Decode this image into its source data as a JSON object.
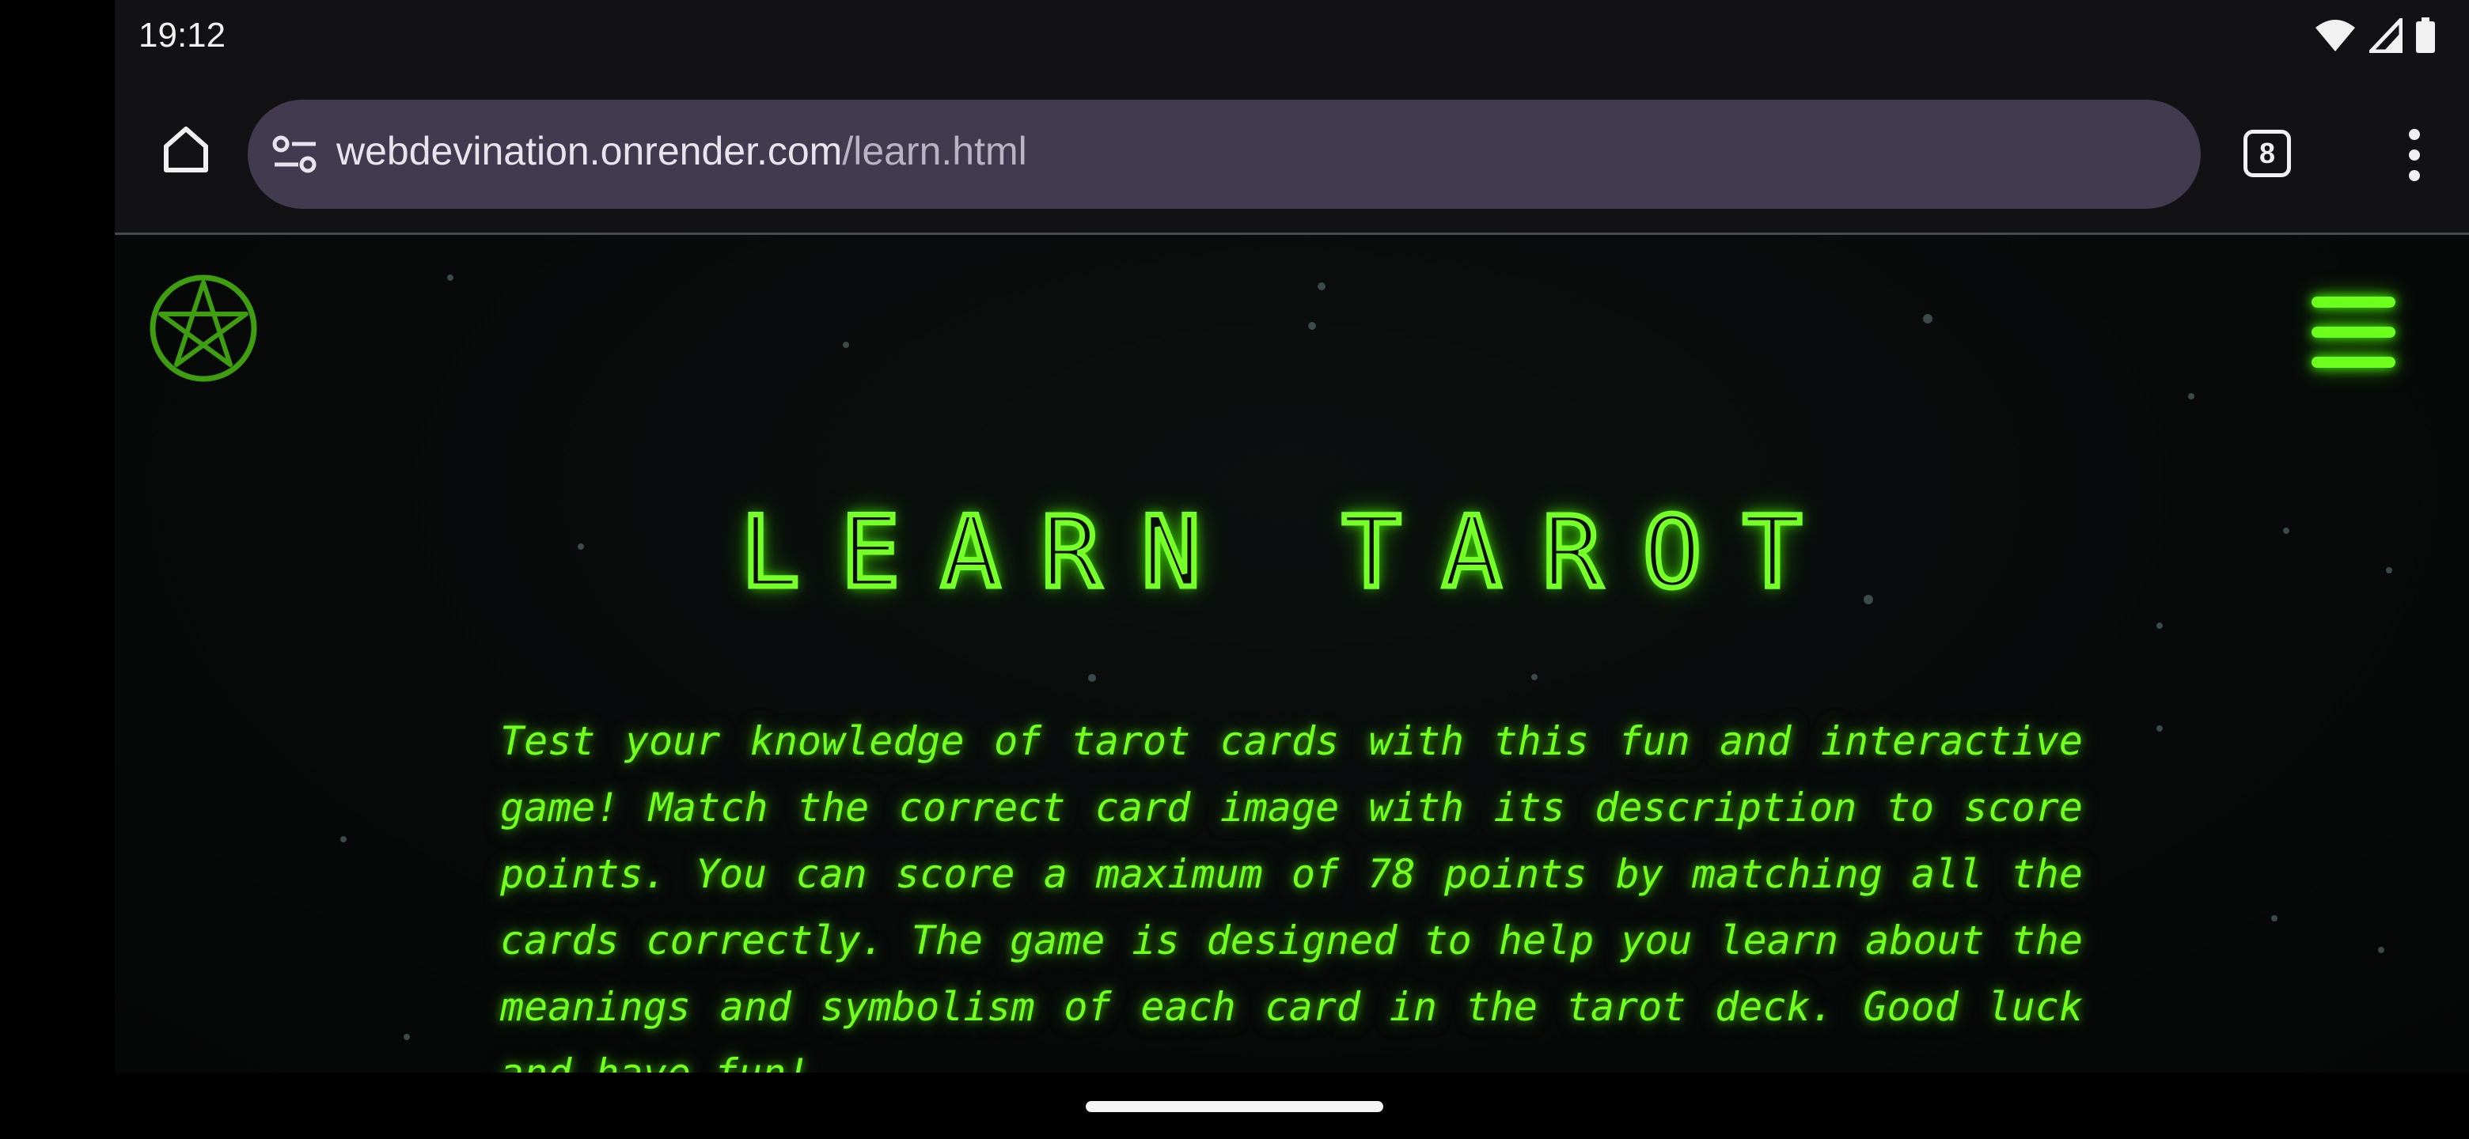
{
  "status_bar": {
    "time": "19:12",
    "icons": [
      "wifi-icon",
      "signal-icon",
      "battery-icon"
    ]
  },
  "browser": {
    "url_host": "webdevination.onrender.com",
    "url_path": "/learn.html",
    "tab_count": "8",
    "icons": [
      "home-icon",
      "site-settings-icon",
      "tabs-icon",
      "more-vert-icon"
    ]
  },
  "page": {
    "logo_icon": "pentagram-icon",
    "menu_icon": "hamburger-icon",
    "title": "LEARN TAROT",
    "description": "Test your knowledge of tarot cards with this fun and interactive game! Match the correct card image with its description to score points. You can score a maximum of 78 points by matching all the cards correctly. The game is designed to help you learn about the meanings and symbolism of each card in the tarot deck. Good luck and have fun!",
    "accent_color": "#72ff20",
    "background_color": "#080a0a"
  }
}
